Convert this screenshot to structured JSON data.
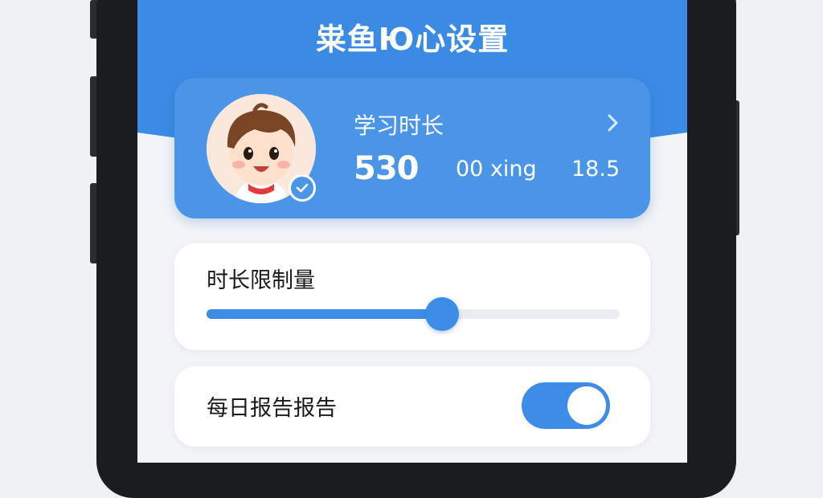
{
  "header": {
    "title": "粜鱼Ю心设置"
  },
  "profile": {
    "study_label": "学习时长",
    "study_value": "530",
    "study_unit": "00 xing",
    "study_secondary": "18.5"
  },
  "limit": {
    "label": "时长限制量",
    "slider_fraction": 0.57
  },
  "daily_report": {
    "label": "每日报告报告",
    "enabled": true
  },
  "colors": {
    "primary": "#3d8de6",
    "card_blue": "#4a95e8",
    "background": "#f2f4f8"
  },
  "icons": [
    "child-avatar-icon",
    "checkmark-icon",
    "chevron-right-icon"
  ]
}
